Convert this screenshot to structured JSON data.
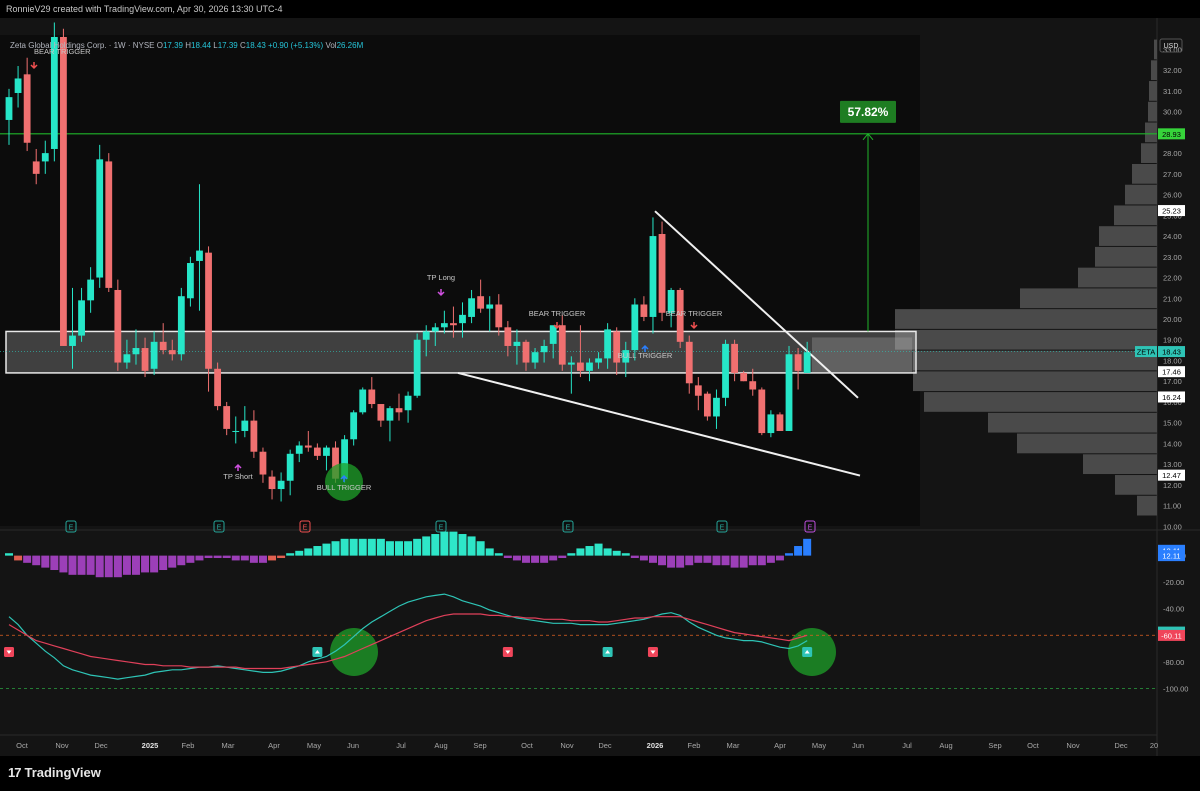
{
  "header": {
    "credit": "RonnieV29 created with TradingView.com, Apr 30, 2026 13:30 UTC-4"
  },
  "legend": {
    "symbol": "Zeta Global Holdings Corp. · 1W · NYSE",
    "open_label": "O",
    "open": "17.39",
    "high_label": "H",
    "high": "18.44",
    "low_label": "L",
    "low": "17.39",
    "close_label": "C",
    "close": "18.43",
    "change": "+0.90 (+5.13%)",
    "vol_label": "Vol",
    "vol": "26.26M"
  },
  "footer": {
    "brand": "TradingView"
  },
  "colors": {
    "bull": "#26e6c8",
    "bear": "#f07070",
    "bg": "#141414",
    "target": "#1fb52a",
    "hist_pos": "#2ee6c8",
    "hist_neg": "#9c3fb8",
    "macd": "#2ec4b6",
    "signal": "#e0405a"
  },
  "chart_data": [
    {
      "type": "candlestick",
      "title": "Zeta Global Holdings Corp. · 1W · NYSE",
      "currency": "USD",
      "ylim": [
        10.5,
        33.6
      ],
      "y_scale": "linear",
      "grid": false,
      "y_ticks": [
        "33.00",
        "32.00",
        "31.00",
        "30.00",
        "29.00",
        "28.00",
        "27.00",
        "26.00",
        "25.00",
        "24.00",
        "23.00",
        "22.00",
        "21.00",
        "20.00",
        "19.00",
        "18.00",
        "17.00",
        "16.00",
        "15.00",
        "14.00",
        "13.00",
        "12.00",
        "11.00",
        "10.00"
      ],
      "x_ticks": [
        "Oct",
        "Nov",
        "Dec",
        "2025",
        "Feb",
        "Mar",
        "Apr",
        "May",
        "Jun",
        "Jul",
        "Aug",
        "Sep",
        "Oct",
        "Nov",
        "Dec",
        "2026",
        "Feb",
        "Mar",
        "Apr",
        "May",
        "Jun",
        "Jul",
        "Aug",
        "Sep",
        "Oct",
        "Nov",
        "Dec",
        "20"
      ],
      "candles": [
        {
          "o": 29.6,
          "h": 31.1,
          "l": 28.4,
          "c": 30.7
        },
        {
          "o": 30.9,
          "h": 32.2,
          "l": 30.2,
          "c": 31.6
        },
        {
          "o": 31.8,
          "h": 32.6,
          "l": 28.1,
          "c": 28.5
        },
        {
          "o": 27.6,
          "h": 28.2,
          "l": 26.5,
          "c": 27.0
        },
        {
          "o": 27.6,
          "h": 28.6,
          "l": 27.0,
          "c": 28.0
        },
        {
          "o": 28.2,
          "h": 34.3,
          "l": 27.6,
          "c": 33.6
        },
        {
          "o": 33.6,
          "h": 34.0,
          "l": 18.7,
          "c": 18.7
        },
        {
          "o": 18.7,
          "h": 21.5,
          "l": 17.6,
          "c": 19.2
        },
        {
          "o": 19.2,
          "h": 21.5,
          "l": 18.9,
          "c": 20.9
        },
        {
          "o": 20.9,
          "h": 22.5,
          "l": 20.3,
          "c": 21.9
        },
        {
          "o": 22.0,
          "h": 28.4,
          "l": 21.5,
          "c": 27.7
        },
        {
          "o": 27.6,
          "h": 28.0,
          "l": 21.3,
          "c": 21.5
        },
        {
          "o": 21.4,
          "h": 21.9,
          "l": 17.5,
          "c": 17.9
        },
        {
          "o": 17.9,
          "h": 19.0,
          "l": 17.6,
          "c": 18.3
        },
        {
          "o": 18.3,
          "h": 19.5,
          "l": 17.8,
          "c": 18.6
        },
        {
          "o": 18.6,
          "h": 19.1,
          "l": 17.2,
          "c": 17.5
        },
        {
          "o": 17.6,
          "h": 19.4,
          "l": 17.3,
          "c": 18.9
        },
        {
          "o": 18.9,
          "h": 19.8,
          "l": 18.3,
          "c": 18.5
        },
        {
          "o": 18.5,
          "h": 19.0,
          "l": 18.0,
          "c": 18.3
        },
        {
          "o": 18.3,
          "h": 21.5,
          "l": 18.0,
          "c": 21.1
        },
        {
          "o": 21.0,
          "h": 23.0,
          "l": 20.6,
          "c": 22.7
        },
        {
          "o": 22.8,
          "h": 26.5,
          "l": 20.4,
          "c": 23.3
        },
        {
          "o": 23.2,
          "h": 23.5,
          "l": 16.5,
          "c": 17.6
        },
        {
          "o": 17.6,
          "h": 17.9,
          "l": 15.6,
          "c": 15.8
        },
        {
          "o": 15.8,
          "h": 16.0,
          "l": 14.4,
          "c": 14.7
        },
        {
          "o": 14.6,
          "h": 15.3,
          "l": 14.0,
          "c": 14.6
        },
        {
          "o": 14.6,
          "h": 15.8,
          "l": 14.3,
          "c": 15.1
        },
        {
          "o": 15.1,
          "h": 15.6,
          "l": 13.3,
          "c": 13.6
        },
        {
          "o": 13.6,
          "h": 13.8,
          "l": 12.1,
          "c": 12.5
        },
        {
          "o": 12.4,
          "h": 12.7,
          "l": 11.3,
          "c": 11.8
        },
        {
          "o": 11.8,
          "h": 12.6,
          "l": 11.2,
          "c": 12.2
        },
        {
          "o": 12.2,
          "h": 13.7,
          "l": 11.5,
          "c": 13.5
        },
        {
          "o": 13.5,
          "h": 14.1,
          "l": 13.1,
          "c": 13.9
        },
        {
          "o": 13.9,
          "h": 14.6,
          "l": 13.6,
          "c": 13.8
        },
        {
          "o": 13.8,
          "h": 14.0,
          "l": 13.2,
          "c": 13.4
        },
        {
          "o": 13.4,
          "h": 13.9,
          "l": 12.7,
          "c": 13.8
        },
        {
          "o": 13.8,
          "h": 14.1,
          "l": 12.1,
          "c": 12.3
        },
        {
          "o": 12.3,
          "h": 14.4,
          "l": 12.1,
          "c": 14.2
        },
        {
          "o": 14.2,
          "h": 15.6,
          "l": 13.9,
          "c": 15.5
        },
        {
          "o": 15.5,
          "h": 16.7,
          "l": 15.4,
          "c": 16.6
        },
        {
          "o": 16.6,
          "h": 17.2,
          "l": 15.7,
          "c": 15.9
        },
        {
          "o": 15.9,
          "h": 15.9,
          "l": 14.8,
          "c": 15.1
        },
        {
          "o": 15.1,
          "h": 15.8,
          "l": 14.1,
          "c": 15.7
        },
        {
          "o": 15.7,
          "h": 16.4,
          "l": 15.1,
          "c": 15.5
        },
        {
          "o": 15.6,
          "h": 16.5,
          "l": 15.0,
          "c": 16.3
        },
        {
          "o": 16.3,
          "h": 19.3,
          "l": 16.2,
          "c": 19.0
        },
        {
          "o": 19.0,
          "h": 19.7,
          "l": 18.2,
          "c": 19.4
        },
        {
          "o": 19.4,
          "h": 19.8,
          "l": 18.7,
          "c": 19.6
        },
        {
          "o": 19.6,
          "h": 20.4,
          "l": 19.3,
          "c": 19.8
        },
        {
          "o": 19.8,
          "h": 20.6,
          "l": 19.1,
          "c": 19.7
        },
        {
          "o": 19.8,
          "h": 20.8,
          "l": 19.1,
          "c": 20.2
        },
        {
          "o": 20.1,
          "h": 21.4,
          "l": 19.8,
          "c": 21.0
        },
        {
          "o": 21.1,
          "h": 21.9,
          "l": 20.3,
          "c": 20.5
        },
        {
          "o": 20.5,
          "h": 21.1,
          "l": 19.4,
          "c": 20.7
        },
        {
          "o": 20.7,
          "h": 21.2,
          "l": 19.2,
          "c": 19.6
        },
        {
          "o": 19.6,
          "h": 19.9,
          "l": 18.2,
          "c": 18.7
        },
        {
          "o": 18.7,
          "h": 19.5,
          "l": 17.8,
          "c": 18.9
        },
        {
          "o": 18.9,
          "h": 19.0,
          "l": 17.5,
          "c": 17.9
        },
        {
          "o": 17.9,
          "h": 18.6,
          "l": 17.6,
          "c": 18.4
        },
        {
          "o": 18.4,
          "h": 19.0,
          "l": 17.9,
          "c": 18.7
        },
        {
          "o": 18.8,
          "h": 19.6,
          "l": 18.1,
          "c": 19.7
        },
        {
          "o": 19.7,
          "h": 20.2,
          "l": 17.5,
          "c": 17.8
        },
        {
          "o": 17.8,
          "h": 18.2,
          "l": 16.4,
          "c": 17.9
        },
        {
          "o": 17.9,
          "h": 19.7,
          "l": 17.2,
          "c": 17.5
        },
        {
          "o": 17.5,
          "h": 18.1,
          "l": 17.0,
          "c": 17.9
        },
        {
          "o": 17.9,
          "h": 18.4,
          "l": 17.6,
          "c": 18.1
        },
        {
          "o": 18.1,
          "h": 19.8,
          "l": 17.6,
          "c": 19.5
        },
        {
          "o": 19.4,
          "h": 19.6,
          "l": 17.3,
          "c": 17.9
        },
        {
          "o": 17.9,
          "h": 18.9,
          "l": 17.2,
          "c": 18.5
        },
        {
          "o": 18.5,
          "h": 21.0,
          "l": 18.0,
          "c": 20.7
        },
        {
          "o": 20.7,
          "h": 21.1,
          "l": 19.9,
          "c": 20.1
        },
        {
          "o": 20.1,
          "h": 24.9,
          "l": 19.3,
          "c": 24.0
        },
        {
          "o": 24.1,
          "h": 24.7,
          "l": 19.9,
          "c": 20.3
        },
        {
          "o": 20.3,
          "h": 21.5,
          "l": 19.6,
          "c": 21.4
        },
        {
          "o": 21.4,
          "h": 21.5,
          "l": 18.6,
          "c": 18.9
        },
        {
          "o": 18.9,
          "h": 19.2,
          "l": 16.4,
          "c": 16.9
        },
        {
          "o": 16.8,
          "h": 17.2,
          "l": 15.6,
          "c": 16.3
        },
        {
          "o": 16.4,
          "h": 16.5,
          "l": 15.1,
          "c": 15.3
        },
        {
          "o": 15.3,
          "h": 16.6,
          "l": 14.7,
          "c": 16.2
        },
        {
          "o": 16.2,
          "h": 19.0,
          "l": 15.8,
          "c": 18.8
        },
        {
          "o": 18.8,
          "h": 19.0,
          "l": 17.0,
          "c": 17.4
        },
        {
          "o": 17.4,
          "h": 17.5,
          "l": 17.0,
          "c": 17.0
        },
        {
          "o": 17.0,
          "h": 17.6,
          "l": 16.3,
          "c": 16.6
        },
        {
          "o": 16.6,
          "h": 16.7,
          "l": 14.4,
          "c": 14.5
        },
        {
          "o": 14.5,
          "h": 15.6,
          "l": 14.3,
          "c": 15.4
        },
        {
          "o": 15.4,
          "h": 15.5,
          "l": 14.6,
          "c": 14.6
        },
        {
          "o": 14.6,
          "h": 18.7,
          "l": 14.6,
          "c": 18.3
        },
        {
          "o": 18.3,
          "h": 18.6,
          "l": 16.6,
          "c": 17.5
        },
        {
          "o": 17.4,
          "h": 18.9,
          "l": 17.4,
          "c": 18.4
        }
      ],
      "zone": {
        "top": 19.4,
        "bottom": 17.4
      },
      "target": {
        "price": 28.93,
        "label": "57.82%"
      },
      "price_labels": [
        {
          "text": "28.93",
          "y": 28.93,
          "style": "target"
        },
        {
          "text": "25.23",
          "y": 25.23,
          "style": "white"
        },
        {
          "text": "18.43",
          "y": 18.43,
          "style": "current",
          "tag": "ZETA"
        },
        {
          "text": "17.46",
          "y": 17.46,
          "style": "white"
        },
        {
          "text": "16.24",
          "y": 16.24,
          "style": "white"
        },
        {
          "text": "12.47",
          "y": 12.47,
          "style": "white"
        }
      ],
      "volume_profile": [
        {
          "price": 33.0,
          "w": 3
        },
        {
          "price": 32.0,
          "w": 6
        },
        {
          "price": 31.0,
          "w": 8
        },
        {
          "price": 30.0,
          "w": 9
        },
        {
          "price": 29.0,
          "w": 12
        },
        {
          "price": 28.0,
          "w": 16
        },
        {
          "price": 27.0,
          "w": 25
        },
        {
          "price": 26.0,
          "w": 32
        },
        {
          "price": 25.0,
          "w": 43
        },
        {
          "price": 24.0,
          "w": 58
        },
        {
          "price": 23.0,
          "w": 62
        },
        {
          "price": 22.0,
          "w": 79
        },
        {
          "price": 21.0,
          "w": 137
        },
        {
          "price": 20.0,
          "w": 262
        },
        {
          "price": 19.0,
          "w": 262
        },
        {
          "price": 18.0,
          "w": 244
        },
        {
          "price": 17.0,
          "w": 244
        },
        {
          "price": 16.0,
          "w": 233
        },
        {
          "price": 15.0,
          "w": 169
        },
        {
          "price": 14.0,
          "w": 140
        },
        {
          "price": 13.0,
          "w": 74
        },
        {
          "price": 12.0,
          "w": 42
        },
        {
          "price": 11.0,
          "w": 20
        }
      ],
      "annotations": [
        {
          "text": "BEAR TRIGGER",
          "i": 0,
          "price": 33.3
        },
        {
          "text": "TP Long",
          "i": 45,
          "price": 23.1
        },
        {
          "text": "BEAR TRIGGER",
          "i": 55,
          "price": 20.7
        },
        {
          "text": "BULL TRIGGER",
          "i": 63,
          "price": 18.3
        },
        {
          "text": "BEAR TRIGGER",
          "i": 74,
          "price": 20.7
        },
        {
          "text": "TP Short",
          "i": 23,
          "price": 12.4
        },
        {
          "text": "BULL TRIGGER",
          "i": 34,
          "price": 11.8
        }
      ],
      "earnings_marks": [
        "E",
        "E",
        "E",
        "E",
        "E",
        "E",
        "E"
      ]
    },
    {
      "type": "line",
      "subtype": "macd-histogram",
      "ylim": [
        -105,
        8
      ],
      "y_ticks": [
        "0.0000",
        "-20.00",
        "-40.00",
        "-60.00",
        "-80.00",
        "-100.00"
      ],
      "series": [
        {
          "values": [
            -46,
            -52,
            -60,
            -66,
            -72,
            -77,
            -83,
            -86,
            -88,
            -90,
            -91,
            -92,
            -93,
            -92,
            -91,
            -90,
            -88,
            -87,
            -86,
            -86,
            -85,
            -84,
            -84,
            -83,
            -84,
            -85,
            -86,
            -87,
            -88,
            -88,
            -87,
            -85,
            -83,
            -80,
            -78,
            -76,
            -72,
            -67,
            -61,
            -55,
            -50,
            -46,
            -42,
            -38,
            -35,
            -33,
            -31,
            -30,
            -29,
            -31,
            -34,
            -36,
            -38,
            -41,
            -43,
            -45,
            -47,
            -48,
            -49,
            -50,
            -51,
            -51,
            -51,
            -52,
            -52,
            -52,
            -52,
            -51,
            -50,
            -49,
            -48,
            -46,
            -44,
            -43,
            -45,
            -50,
            -54,
            -57,
            -60,
            -62,
            -63,
            -64,
            -64,
            -65,
            -67,
            -69,
            -70,
            -68,
            -64
          ]
        },
        {
          "values": [
            -52,
            -56,
            -60,
            -64,
            -66,
            -68,
            -70,
            -72,
            -74,
            -76,
            -77,
            -78,
            -79,
            -80,
            -81,
            -82,
            -82,
            -83,
            -83,
            -83,
            -84,
            -84,
            -84,
            -84,
            -84,
            -84,
            -85,
            -85,
            -85,
            -85,
            -85,
            -84,
            -83,
            -82,
            -81,
            -80,
            -78,
            -76,
            -73,
            -70,
            -67,
            -64,
            -61,
            -58,
            -55,
            -52,
            -49,
            -47,
            -45,
            -44,
            -44,
            -44,
            -44,
            -45,
            -45,
            -46,
            -46,
            -47,
            -47,
            -48,
            -48,
            -48,
            -49,
            -49,
            -49,
            -50,
            -50,
            -49,
            -48,
            -47,
            -47,
            -46,
            -46,
            -46,
            -46,
            -48,
            -50,
            -52,
            -54,
            -56,
            -58,
            -59,
            -60,
            -61,
            -62,
            -63,
            -64,
            -62,
            -60
          ]
        }
      ],
      "histogram": [
        1,
        -2,
        -3,
        -4,
        -5,
        -6,
        -7,
        -8,
        -8,
        -8,
        -9,
        -9,
        -9,
        -8,
        -8,
        -7,
        -7,
        -6,
        -5,
        -4,
        -3,
        -2,
        -1,
        -1,
        -1,
        -2,
        -2,
        -3,
        -3,
        -2,
        -1,
        1,
        2,
        3,
        4,
        5,
        6,
        7,
        7,
        7,
        7,
        7,
        6,
        6,
        6,
        7,
        8,
        9,
        10,
        10,
        9,
        8,
        6,
        3,
        1,
        -1,
        -2,
        -3,
        -3,
        -3,
        -2,
        -1,
        1,
        3,
        4,
        5,
        3,
        2,
        1,
        -1,
        -2,
        -3,
        -4,
        -5,
        -5,
        -4,
        -3,
        -3,
        -4,
        -4,
        -5,
        -5,
        -4,
        -4,
        -3,
        -2,
        1,
        4,
        7
      ],
      "price_labels": [
        {
          "text": "12.11",
          "y": 4,
          "style": "blue"
        },
        {
          "text": "12.11",
          "y": 0,
          "style": "blue"
        },
        {
          "text": "-57.61",
          "y": -57.61,
          "style": "macd"
        },
        {
          "text": "-60.11",
          "y": -60.11,
          "style": "signal"
        }
      ],
      "levels": [
        -60,
        -100
      ],
      "signals": [
        {
          "i": 0,
          "kind": "sell"
        },
        {
          "i": 34,
          "kind": "buy"
        },
        {
          "i": 55,
          "kind": "sell"
        },
        {
          "i": 66,
          "kind": "buy"
        },
        {
          "i": 71,
          "kind": "sell"
        },
        {
          "i": 88,
          "kind": "buy"
        }
      ]
    }
  ]
}
